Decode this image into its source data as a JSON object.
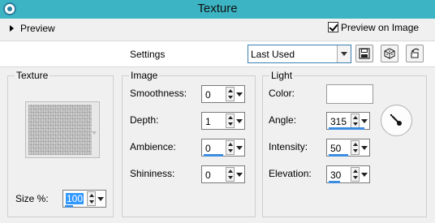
{
  "window": {
    "title": "Texture"
  },
  "preview": {
    "label": "Preview",
    "on_image_label": "Preview on Image",
    "on_image_checked": true
  },
  "settings": {
    "label": "Settings",
    "preset_value": "Last Used"
  },
  "toolbar": {
    "icons": [
      "save-preset-icon",
      "randomize-icon",
      "reset-icon"
    ]
  },
  "texture_group": {
    "title": "Texture",
    "size_label": "Size %:",
    "size_value": "100"
  },
  "image_group": {
    "title": "Image",
    "smoothness": {
      "label": "Smoothness:",
      "value": "0"
    },
    "depth": {
      "label": "Depth:",
      "value": "1"
    },
    "ambience": {
      "label": "Ambience:",
      "value": "0"
    },
    "shininess": {
      "label": "Shininess:",
      "value": "0"
    }
  },
  "light_group": {
    "title": "Light",
    "color_label": "Color:",
    "color_value": "#ffffff",
    "angle": {
      "label": "Angle:",
      "value": "315"
    },
    "intensity": {
      "label": "Intensity:",
      "value": "50"
    },
    "elevation": {
      "label": "Elevation:",
      "value": "30"
    }
  },
  "colors": {
    "titlebar": "#3cb4c3",
    "accent": "#3c8de0"
  }
}
